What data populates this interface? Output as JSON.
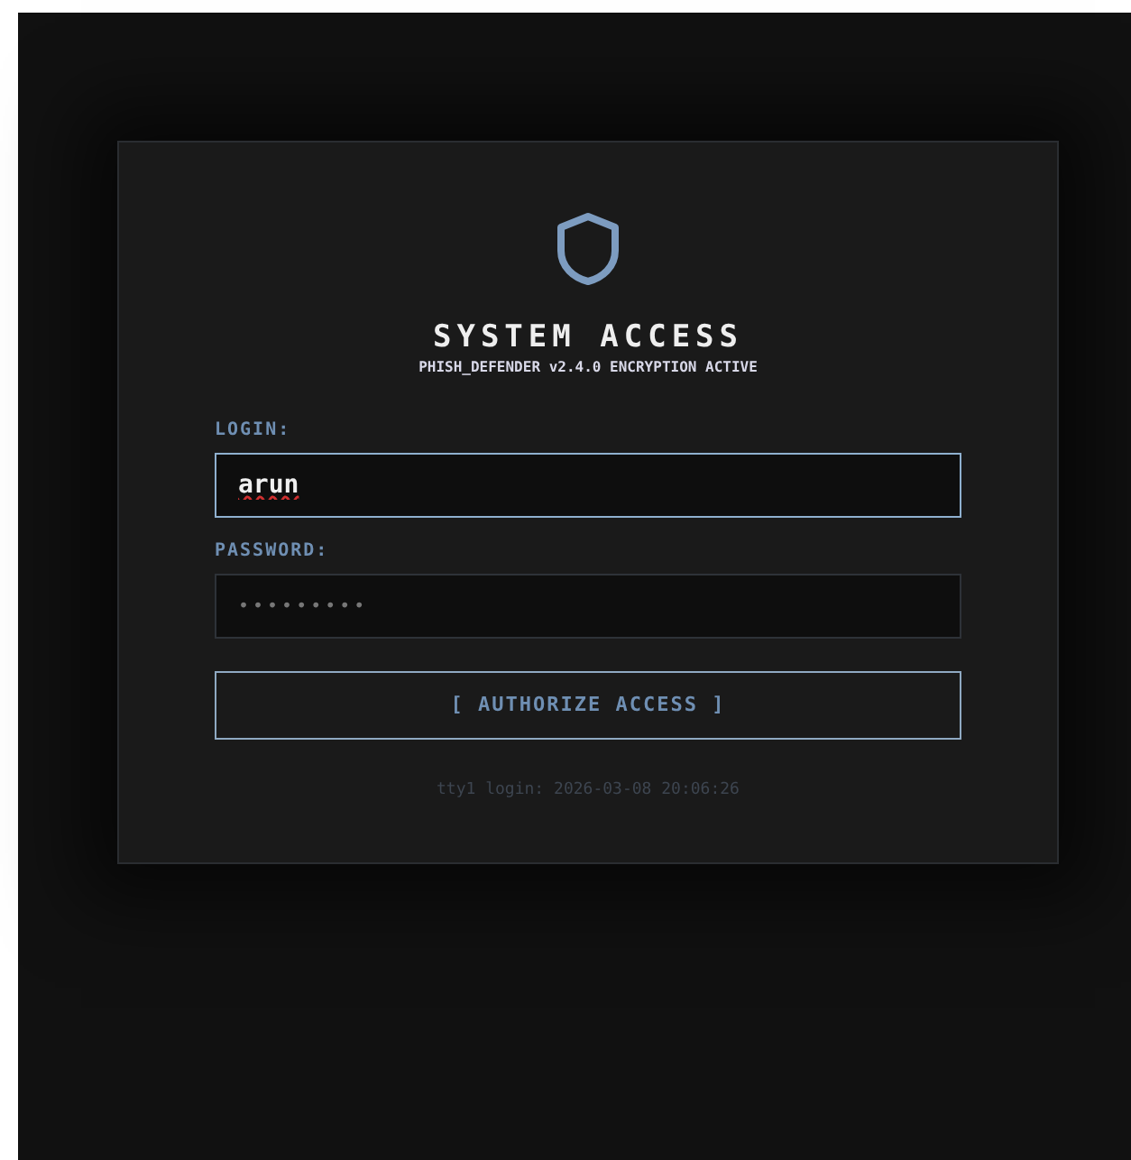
{
  "title": "SYSTEM ACCESS",
  "subtitle": "PHISH_DEFENDER v2.4.0 ENCRYPTION ACTIVE",
  "fields": [
    {
      "label": "LOGIN:",
      "value": "arun",
      "kind": "text",
      "focused": true
    },
    {
      "label": "PASSWORD:",
      "value": "•••••••••",
      "kind": "password",
      "focused": false
    }
  ],
  "button": "[ AUTHORIZE ACCESS ]",
  "footer": "tty1 login: 2026-03-08 20:06:26"
}
